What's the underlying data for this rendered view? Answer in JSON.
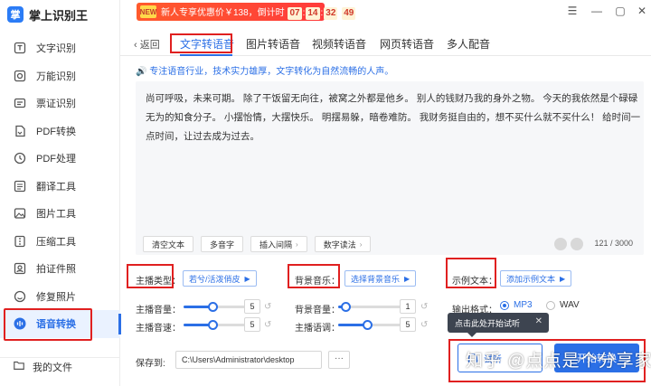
{
  "app": {
    "logo_text": "掌",
    "title": "掌上识别王"
  },
  "promo": {
    "tag": "NEW",
    "text": "新人专享优惠价￥138，倒计时",
    "countdown": [
      "07",
      "14",
      "32",
      "49"
    ]
  },
  "window_controls": {
    "menu": "☰",
    "minimize": "—",
    "maximize": "▢",
    "close": "✕"
  },
  "sidebar": {
    "items": [
      {
        "label": "文字识别",
        "icon": "text-scan-icon"
      },
      {
        "label": "万能识别",
        "icon": "universal-scan-icon"
      },
      {
        "label": "票证识别",
        "icon": "ticket-scan-icon"
      },
      {
        "label": "PDF转换",
        "icon": "pdf-convert-icon"
      },
      {
        "label": "PDF处理",
        "icon": "pdf-process-icon"
      },
      {
        "label": "翻译工具",
        "icon": "translate-icon"
      },
      {
        "label": "图片工具",
        "icon": "image-tools-icon"
      },
      {
        "label": "压缩工具",
        "icon": "compress-icon"
      },
      {
        "label": "拍证件照",
        "icon": "id-photo-icon"
      },
      {
        "label": "修复照片",
        "icon": "photo-repair-icon"
      },
      {
        "label": "语音转换",
        "icon": "voice-convert-icon",
        "active": true
      }
    ],
    "my_files": "我的文件"
  },
  "tabs": {
    "back_label": "返回",
    "items": [
      "文字转语音",
      "图片转语音",
      "视频转语音",
      "网页转语音",
      "多人配音"
    ],
    "active_index": 0
  },
  "subtitle": "专注语音行业，技术实力雄厚，文字转化为自然流畅的人声。",
  "editor": {
    "text": "尚可呼吸，未来可期。 除了干饭留无向往，被窝之外都是他乡。 别人的钱财乃我的身外之物。 今天的我依然是个碌碌无为的知食分子。 小摆怡情，大摆快乐。 明摆易躲，暗卷难防。 我财务挺自由的，想不买什么就不买什么！ 给时间一点时间，让过去成为过去。",
    "tools": [
      "清空文本",
      "多音字",
      "插入间隔",
      "数字读法"
    ],
    "tool_arrows": [
      false,
      false,
      true,
      true
    ],
    "char_count": "121 / 3000"
  },
  "settings": {
    "voice_type_label": "主播类型：",
    "voice_type_value": "若兮/活泼俏皮",
    "bgm_label": "背景音乐：",
    "bgm_value": "选择背景音乐",
    "sample_label": "示例文本：",
    "sample_value": "添加示例文本",
    "volume_label": "主播音量：",
    "volume_value": "5",
    "volume_fraction": 0.45,
    "speed_label": "主播音速：",
    "speed_value": "5",
    "speed_fraction": 0.45,
    "bg_volume_label": "背景音量：",
    "bg_volume_value": "1",
    "bg_volume_fraction": 0.05,
    "pitch_label": "主播语调：",
    "pitch_value": "5",
    "pitch_fraction": 0.45,
    "format_label": "输出格式：",
    "formats": [
      "MP3",
      "WAV"
    ],
    "format_selected": 0
  },
  "tooltip": {
    "text": "点击此处开始试听",
    "close": "✕"
  },
  "save": {
    "label": "保存到:",
    "path": "C:\\Users\\Administrator\\desktop",
    "browse": "···"
  },
  "buttons": {
    "play": "试听",
    "start": "开始转换"
  },
  "watermark": "知乎 @点点是个分享家",
  "colors": {
    "accent": "#2b6fe6",
    "highlight": "#e02020",
    "promo": "#ff3b3b"
  }
}
